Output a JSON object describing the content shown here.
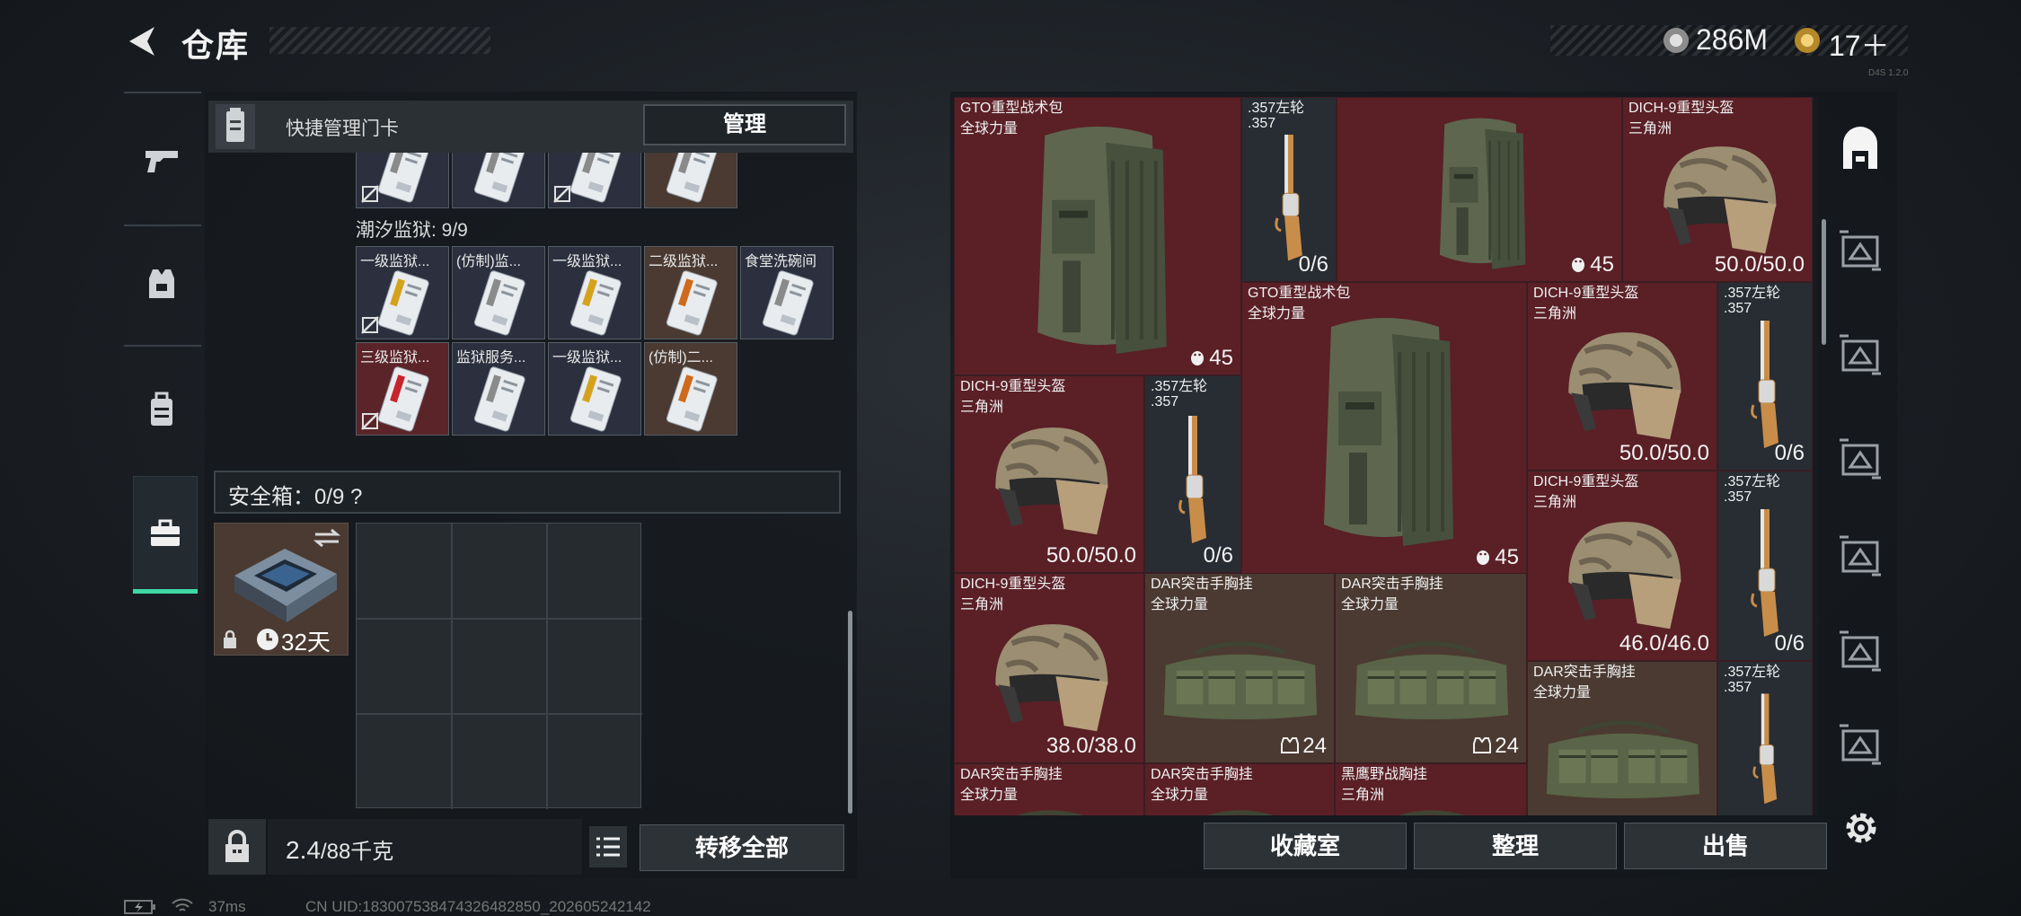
{
  "header": {
    "title": "仓库",
    "coins": "286M",
    "tickets": "17＋",
    "version": "D4S 1.2.0"
  },
  "left_tabs": [
    {
      "name": "weapons-tab",
      "icon": "pistol-icon"
    },
    {
      "name": "armor-tab",
      "icon": "vest-icon"
    },
    {
      "name": "backpack-tab",
      "icon": "backpack-icon"
    },
    {
      "name": "safebox-tab",
      "icon": "briefcase-icon",
      "active": true
    }
  ],
  "keycards": {
    "header_label": "快捷管理门卡",
    "manage_label": "管理",
    "group_title": "潮汐监狱: 9/9",
    "top_row_count": 4,
    "cards": [
      {
        "label": "一级监狱...",
        "bg": "dark",
        "stripe": "#d4a21c"
      },
      {
        "label": "(仿制)监...",
        "bg": "dark",
        "stripe": "#8a8a8a"
      },
      {
        "label": "一级监狱...",
        "bg": "dark",
        "stripe": "#d4a21c"
      },
      {
        "label": "二级监狱...",
        "bg": "brown",
        "stripe": "#cf6a1c"
      },
      {
        "label": "食堂洗碗间",
        "bg": "dark",
        "stripe": "#8a8a8a"
      },
      {
        "label": "三级监狱...",
        "bg": "red",
        "stripe": "#c8242c"
      },
      {
        "label": "监狱服务...",
        "bg": "dark",
        "stripe": "#8a8a8a"
      },
      {
        "label": "一级监狱...",
        "bg": "dark",
        "stripe": "#d4a21c"
      },
      {
        "label": "(仿制)二...",
        "bg": "brown",
        "stripe": "#cf6a1c"
      }
    ]
  },
  "safebox": {
    "label": "安全箱：0/9  ?",
    "duration": "32天"
  },
  "weight": {
    "value": "2.4",
    "max": "/88千克"
  },
  "buttons": {
    "transfer_all": "转移全部",
    "collection": "收藏室",
    "sort": "整理",
    "sell": "出售"
  },
  "inventory": [
    {
      "id": "gto-bag-1",
      "name": "GTO重型战术包",
      "sub": "全球力量",
      "stat": "45",
      "kind": "bag",
      "bg": "red",
      "stat_icon": "penguin"
    },
    {
      "id": "revolver-1",
      "name": ".357左轮",
      "sub": ".357",
      "stat": "0/6",
      "kind": "gun",
      "bg": "dark"
    },
    {
      "id": "gto-bag-2",
      "name": "",
      "sub": "",
      "stat": "45",
      "kind": "bag",
      "bg": "red",
      "stat_icon": "penguin"
    },
    {
      "id": "helmet-1",
      "name": "DICH-9重型头盔",
      "sub": "三角洲",
      "stat": "50.0/50.0",
      "kind": "helmet",
      "bg": "red"
    },
    {
      "id": "gto-bag-3",
      "name": "GTO重型战术包",
      "sub": "全球力量",
      "stat": "45",
      "kind": "bag",
      "bg": "red",
      "stat_icon": "penguin"
    },
    {
      "id": "helmet-2",
      "name": "DICH-9重型头盔",
      "sub": "三角洲",
      "stat": "50.0/50.0",
      "kind": "helmet",
      "bg": "red"
    },
    {
      "id": "revolver-2",
      "name": ".357左轮",
      "sub": ".357",
      "stat": "0/6",
      "kind": "gun",
      "bg": "dark"
    },
    {
      "id": "helmet-3",
      "name": "DICH-9重型头盔",
      "sub": "三角洲",
      "stat": "50.0/50.0",
      "kind": "helmet",
      "bg": "red"
    },
    {
      "id": "revolver-3",
      "name": ".357左轮",
      "sub": ".357",
      "stat": "0/6",
      "kind": "gun",
      "bg": "dark"
    },
    {
      "id": "helmet-4",
      "name": "DICH-9重型头盔",
      "sub": "三角洲",
      "stat": "46.0/46.0",
      "kind": "helmet",
      "bg": "red"
    },
    {
      "id": "revolver-4",
      "name": ".357左轮",
      "sub": ".357",
      "stat": "0/6",
      "kind": "gun",
      "bg": "dark"
    },
    {
      "id": "helmet-5",
      "name": "DICH-9重型头盔",
      "sub": "三角洲",
      "stat": "38.0/38.0",
      "kind": "helmet",
      "bg": "red"
    },
    {
      "id": "dar-rig-1",
      "name": "DAR突击手胸挂",
      "sub": "全球力量",
      "stat": "24",
      "kind": "rig",
      "bg": "brown",
      "stat_icon": "vest"
    },
    {
      "id": "dar-rig-2",
      "name": "DAR突击手胸挂",
      "sub": "全球力量",
      "stat": "24",
      "kind": "rig",
      "bg": "brown",
      "stat_icon": "vest"
    },
    {
      "id": "dar-rig-3",
      "name": "DAR突击手胸挂",
      "sub": "全球力量",
      "stat": "",
      "kind": "rig",
      "bg": "brown"
    },
    {
      "id": "revolver-5",
      "name": ".357左轮",
      "sub": ".357",
      "stat": "",
      "kind": "gun",
      "bg": "dark"
    },
    {
      "id": "dar-rig-4",
      "name": "DAR突击手胸挂",
      "sub": "全球力量",
      "stat": "",
      "kind": "rig",
      "bg": "red"
    },
    {
      "id": "dar-rig-5",
      "name": "DAR突击手胸挂",
      "sub": "全球力量",
      "stat": "",
      "kind": "rig",
      "bg": "red"
    },
    {
      "id": "blackhawk-rig",
      "name": "黑鹰野战胸挂",
      "sub": "三角洲",
      "stat": "",
      "kind": "rig",
      "bg": "red"
    }
  ],
  "status_bar": {
    "ping": "37ms",
    "uid": "CN UID:183007538474326482850_202605242142"
  },
  "colors": {
    "accent": "#3fd8a4",
    "red_item": "#5a2026",
    "brown_item": "#4b3a31"
  }
}
